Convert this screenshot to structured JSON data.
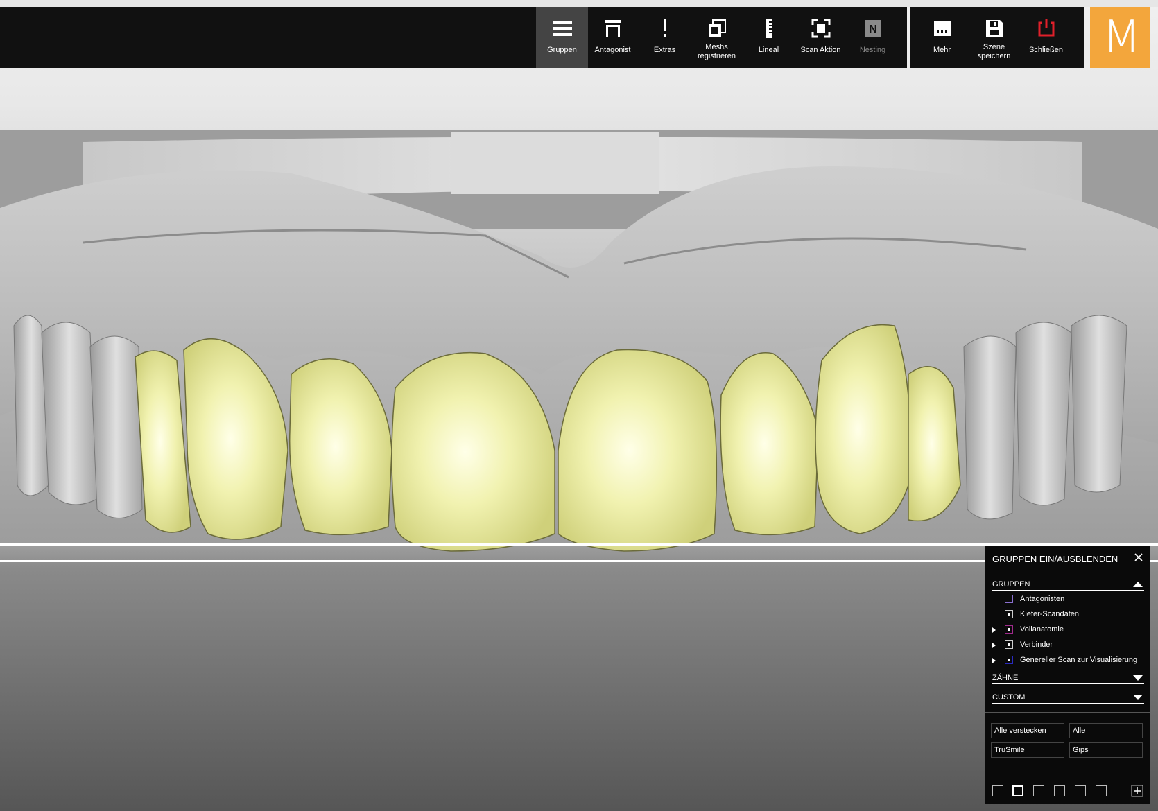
{
  "toolbar": {
    "items": [
      {
        "label": "Gruppen",
        "icon": "menu-icon",
        "active": true
      },
      {
        "label": "Antagonist",
        "icon": "antagonist-icon"
      },
      {
        "label": "Extras",
        "icon": "exclamation-icon"
      },
      {
        "label": "Meshs registrieren",
        "icon": "mesh-register-icon"
      },
      {
        "label": "Lineal",
        "icon": "ruler-icon"
      },
      {
        "label": "Scan Aktion",
        "icon": "scan-icon"
      },
      {
        "label": "Nesting",
        "icon": "nesting-icon",
        "disabled": true
      }
    ],
    "right_items": [
      {
        "label": "Mehr",
        "icon": "more-icon"
      },
      {
        "label": "Szene speichern",
        "icon": "save-icon"
      },
      {
        "label": "Schließen",
        "icon": "power-icon",
        "color": "#e0202a"
      }
    ],
    "nesting_glyph": "N",
    "brand_letter": "M",
    "brand_color": "#f3a63c"
  },
  "panel": {
    "title": "GRUPPEN EIN/AUSBLENDEN",
    "sections": {
      "gruppen": "GRUPPEN",
      "zaehne": "ZÄHNE",
      "custom": "CUSTOM"
    },
    "groups": [
      {
        "name": "Antagonisten",
        "expandable": false,
        "checked": false,
        "color": "#8a6fd0"
      },
      {
        "name": "Kiefer-Scandaten",
        "expandable": false,
        "checked": true,
        "color": "#cccccc"
      },
      {
        "name": "Vollanatomie",
        "expandable": true,
        "checked": true,
        "color": "#a02a8c"
      },
      {
        "name": "Verbinder",
        "expandable": true,
        "checked": true,
        "color": "#cccccc"
      },
      {
        "name": "Genereller Scan zur Visualisierung",
        "expandable": true,
        "checked": true,
        "color": "#2a2ac0"
      }
    ],
    "buttons": [
      "Alle verstecken",
      "Alle",
      "TruSmile",
      "Gips"
    ]
  },
  "colors": {
    "tooth_fill": "#e9ea9c",
    "gingiva": "#b9b9b9"
  }
}
